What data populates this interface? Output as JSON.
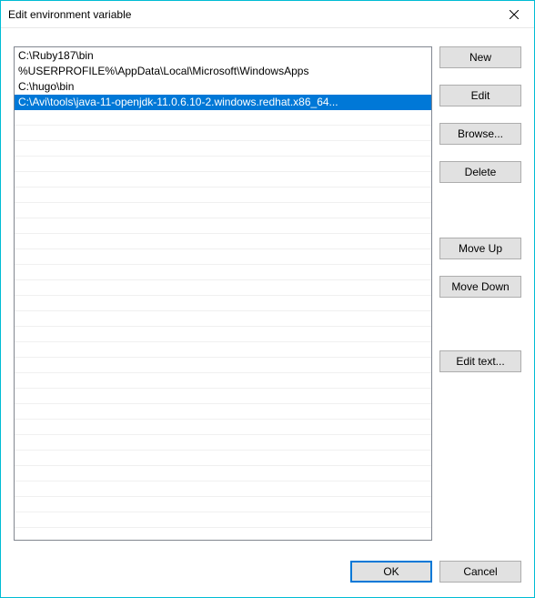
{
  "window": {
    "title": "Edit environment variable"
  },
  "list": {
    "items": [
      {
        "text": "C:\\Ruby187\\bin",
        "selected": false
      },
      {
        "text": "%USERPROFILE%\\AppData\\Local\\Microsoft\\WindowsApps",
        "selected": false
      },
      {
        "text": "C:\\hugo\\bin",
        "selected": false
      },
      {
        "text": "C:\\Avi\\tools\\java-11-openjdk-11.0.6.10-2.windows.redhat.x86_64...",
        "selected": true
      }
    ]
  },
  "buttons": {
    "new": "New",
    "edit": "Edit",
    "browse": "Browse...",
    "delete": "Delete",
    "moveup": "Move Up",
    "movedown": "Move Down",
    "edittext": "Edit text...",
    "ok": "OK",
    "cancel": "Cancel"
  }
}
